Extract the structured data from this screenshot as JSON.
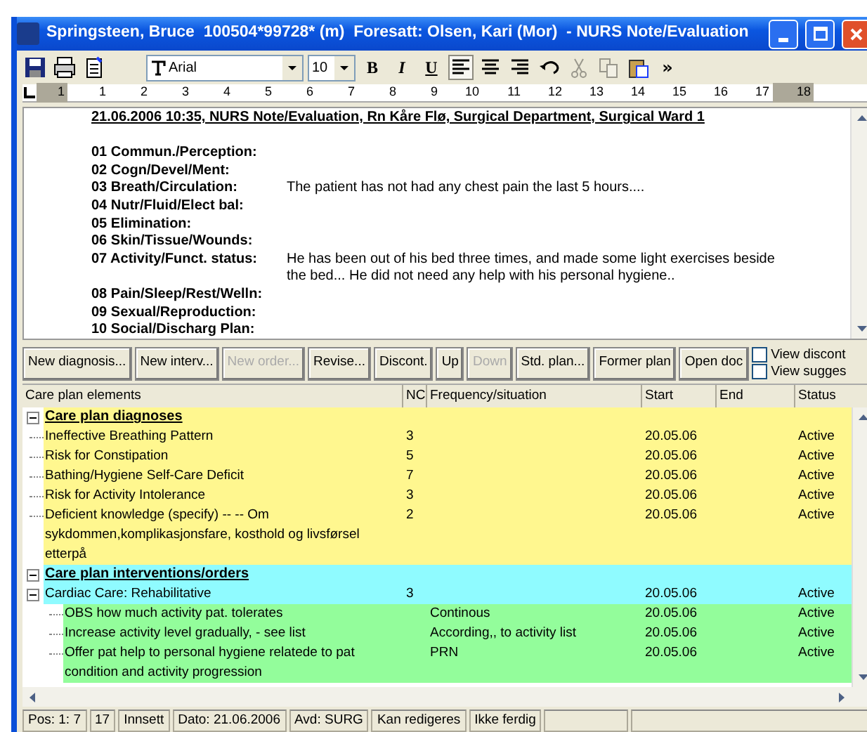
{
  "window": {
    "title": "Springsteen, Bruce  100504*99728* (m)  Foresatt: Olsen, Kari (Mor)  - NURS Note/Evaluation"
  },
  "toolbar": {
    "file_icons": [
      {
        "kind": "save"
      },
      {
        "kind": "print"
      },
      {
        "kind": "clipboard"
      }
    ],
    "font": "Arial",
    "size": "10",
    "format_buttons": [
      {
        "label": "B",
        "kind": "bold"
      },
      {
        "label": "I",
        "kind": "italic"
      },
      {
        "label": "U",
        "kind": "underline"
      }
    ],
    "align_buttons": [
      {
        "kind": "left",
        "selected": true
      },
      {
        "kind": "center",
        "selected": false
      },
      {
        "kind": "right",
        "selected": false
      }
    ],
    "edit_icons": [
      {
        "kind": "undo",
        "disabled": false
      },
      {
        "kind": "cut",
        "disabled": true
      },
      {
        "kind": "copy",
        "disabled": true
      },
      {
        "kind": "paste",
        "disabled": false
      }
    ],
    "more": "»"
  },
  "ruler": {
    "labels": [
      "1",
      "1",
      "2",
      "3",
      "4",
      "5",
      "6",
      "7",
      "8",
      "9",
      "10",
      "11",
      "12",
      "13",
      "14",
      "15",
      "16",
      "17",
      "18"
    ]
  },
  "note": {
    "heading": "21.06.2006 10:35, NURS Note/Evaluation, Rn Kåre Flø, Surgical Department, Surgical Ward 1",
    "sections": [
      {
        "label": "01 Commun./Perception:"
      },
      {
        "label": "02 Cogn/Devel/Ment:"
      },
      {
        "label": "03 Breath/Circulation:",
        "text": "The patient has not had any chest pain the last 5 hours...."
      },
      {
        "label": "04 Nutr/Fluid/Elect bal:"
      },
      {
        "label": "05 Elimination:"
      },
      {
        "label": "06 Skin/Tissue/Wounds:"
      },
      {
        "label": "07 Activity/Funct. status:",
        "text": "He has been out of his bed three times, and made some light exercises beside the bed... He did not need any help with his personal hygiene.."
      },
      {
        "label": "08 Pain/Sleep/Rest/Welln:"
      },
      {
        "label": "09 Sexual/Reproduction:"
      },
      {
        "label": "10 Social/Discharg Plan:"
      }
    ]
  },
  "buttons": [
    {
      "label": "New diagnosis...",
      "disabled": false
    },
    {
      "label": "New interv...",
      "disabled": false
    },
    {
      "label": "New order...",
      "disabled": true
    },
    {
      "label": "Revise...",
      "disabled": false
    },
    {
      "label": "Discont.",
      "disabled": false
    },
    {
      "label": "Up",
      "disabled": false
    },
    {
      "label": "Down",
      "disabled": true
    },
    {
      "label": "Std. plan...",
      "disabled": false
    },
    {
      "label": "Former plan",
      "disabled": false
    },
    {
      "label": "Open doc",
      "disabled": false
    }
  ],
  "options": [
    {
      "label": "View discont",
      "checked": false
    },
    {
      "label": "View sugges",
      "checked": false
    }
  ],
  "table": {
    "columns": [
      "Care plan elements",
      "NC",
      "Frequency/situation",
      "Start",
      "End",
      "Status"
    ],
    "rows": [
      {
        "kind": "group",
        "name": "Care plan diagnoses",
        "color": "#fff78f",
        "expanded": true,
        "children": [
          {
            "kind": "item",
            "name": "Ineffective Breathing Pattern",
            "nc": "3",
            "start": "20.05.06",
            "status": "Active",
            "color": "#fff78f"
          },
          {
            "kind": "item",
            "name": "Risk for Constipation",
            "nc": "5",
            "start": "20.05.06",
            "status": "Active",
            "color": "#fff78f"
          },
          {
            "kind": "item",
            "name": "Bathing/Hygiene Self-Care Deficit",
            "nc": "7",
            "start": "20.05.06",
            "status": "Active",
            "color": "#fff78f"
          },
          {
            "kind": "item",
            "name": "Risk for Activity Intolerance",
            "nc": "3",
            "start": "20.05.06",
            "status": "Active",
            "color": "#fff78f"
          },
          {
            "kind": "item",
            "name": "Deficient knowledge (specify) -- -- Om sykdommen,komplikasjonsfare, kosthold og livsførsel etterpå",
            "nc": "2",
            "start": "20.05.06",
            "status": "Active",
            "color": "#fff78f"
          }
        ]
      },
      {
        "kind": "group",
        "name": "Care plan interventions/orders",
        "color": "#8ffbff",
        "expanded": true,
        "children": [
          {
            "kind": "item",
            "name": "Cardiac Care: Rehabilitative",
            "nc": "3",
            "start": "20.05.06",
            "status": "Active",
            "color": "#8ffbff",
            "expanded": true,
            "children": [
              {
                "kind": "item",
                "name": "OBS how much activity pat. tolerates",
                "frequency": "Continous",
                "start": "20.05.06",
                "status": "Active",
                "color": "#93fd9b"
              },
              {
                "kind": "item",
                "name": "Increase activity level gradually, - see list",
                "frequency": "According,, to activity list",
                "start": "20.05.06",
                "status": "Active",
                "color": "#93fd9b"
              },
              {
                "kind": "item",
                "name": "Offer pat help to personal hygiene relatede to pat condition and activity progression",
                "frequency": "PRN",
                "start": "20.05.06",
                "status": "Active",
                "color": "#93fd9b"
              }
            ]
          }
        ]
      }
    ]
  },
  "status_bar": [
    "Pos: 1: 7",
    "17",
    "Innsett",
    "Dato: 21.06.2006",
    "Avd: SURG",
    "Kan redigeres",
    "Ikke ferdig"
  ]
}
